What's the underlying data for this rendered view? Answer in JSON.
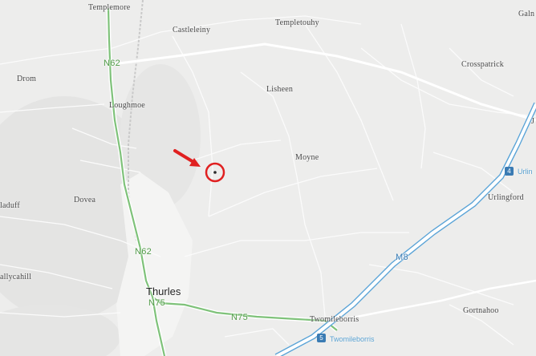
{
  "map": {
    "places": [
      {
        "id": "templemore",
        "name": "Templemore"
      },
      {
        "id": "castleleiny",
        "name": "Castleleiny"
      },
      {
        "id": "templetouhy",
        "name": "Templetouhy"
      },
      {
        "id": "galmoy",
        "name": "Galn"
      },
      {
        "id": "drom",
        "name": "Drom"
      },
      {
        "id": "crosspatrick",
        "name": "Crosspatrick"
      },
      {
        "id": "loughmoe",
        "name": "Loughmoe"
      },
      {
        "id": "lisheen",
        "name": "Lisheen"
      },
      {
        "id": "moyne",
        "name": "Moyne"
      },
      {
        "id": "dovea",
        "name": "Dovea"
      },
      {
        "id": "holycross-edge",
        "name": "laduff"
      },
      {
        "id": "urlingford",
        "name": "Urlingford"
      },
      {
        "id": "ballycahill",
        "name": "allycahill"
      },
      {
        "id": "twomileborris",
        "name": "Twomileborris"
      },
      {
        "id": "gortnahoo",
        "name": "Gortnahoo"
      }
    ],
    "town_label": "Thurles",
    "road_labels": {
      "n62_north": "N62",
      "n62_south": "N62",
      "n75_west": "N75",
      "n75_east": "N75",
      "m8": "M8"
    },
    "junctions": [
      {
        "id": "junction-4",
        "number": "4",
        "label": "Urlin"
      },
      {
        "id": "junction-5",
        "number": "5",
        "label": "Twomileborris"
      }
    ],
    "edge_label": "J",
    "marker": {
      "icon": "red-arrow-icon",
      "ring": "red-circle-icon",
      "color": "#e02020"
    },
    "colors": {
      "background": "#ededec",
      "national_road": "#7fc27a",
      "motorway": "#5aa3d6",
      "town_area": "#f5f5f5"
    }
  }
}
